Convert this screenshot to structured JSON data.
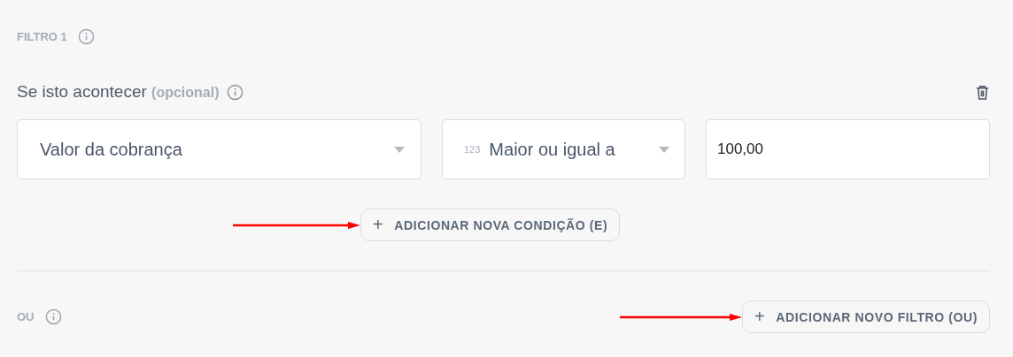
{
  "filter": {
    "title": "FILTRO 1"
  },
  "condition": {
    "label": "Se isto acontecer",
    "optional": "(opcional)"
  },
  "fields": [
    {
      "kind": "select",
      "value": "Valor da cobrança"
    },
    {
      "kind": "select",
      "prefix": "123",
      "value": "Maior ou igual a"
    },
    {
      "kind": "input",
      "value": "100,00"
    }
  ],
  "add_condition": {
    "label": "ADICIONAR NOVA CONDIÇÃO (E)",
    "plus": "+"
  },
  "or_section": {
    "label": "OU"
  },
  "add_filter": {
    "label": "ADICIONAR NOVO FILTRO (OU)",
    "plus": "+"
  }
}
